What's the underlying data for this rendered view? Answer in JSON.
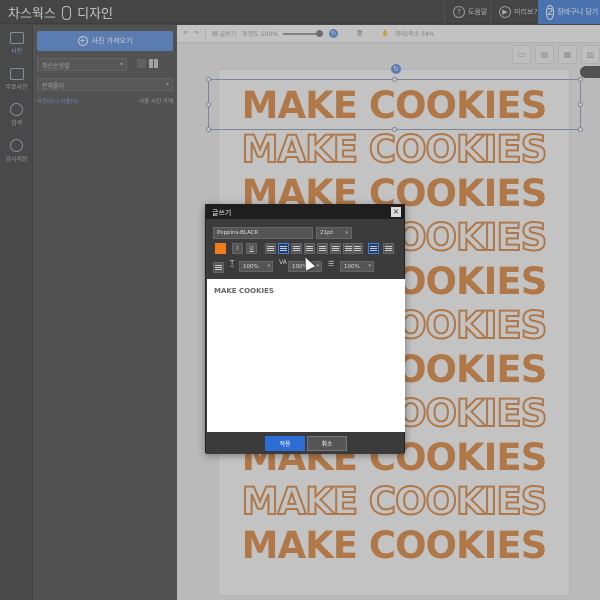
{
  "header": {
    "brand_left": "차스웍스",
    "brand_right": "디자인",
    "buttons": [
      {
        "label": "도움말",
        "icon": "question-icon"
      },
      {
        "label": "미리보기",
        "icon": "play-icon"
      },
      {
        "label": "장바구니 담기",
        "icon": "step-2-icon",
        "step": "2"
      }
    ]
  },
  "rail": [
    {
      "label": "사진",
      "icon": "photo-icon"
    },
    {
      "label": "무료사진",
      "icon": "free-photo-icon"
    },
    {
      "label": "검색",
      "icon": "search-icon"
    },
    {
      "label": "임시저장",
      "icon": "save-icon"
    }
  ],
  "panel": {
    "import_label": "사진 가져오기",
    "sort_value": "최신순정렬",
    "folder_value": "전체폴더",
    "row_left": "사진(0) | 사용(0)",
    "row_right": "사용 사진 삭제"
  },
  "toolbar": {
    "items": [
      "글쓰기",
      "투명도 100%",
      "확대/축소 34%"
    ]
  },
  "poster": {
    "lines": [
      {
        "text": "MAKE COOKIES",
        "style": "solid"
      },
      {
        "text": "MAKE COOKIES",
        "style": "outline"
      },
      {
        "text": "MAKE COOKIES",
        "style": "solid"
      },
      {
        "text": "MAKE COOKIES",
        "style": "outline"
      },
      {
        "text": "MAKE COOKIES",
        "style": "solid"
      },
      {
        "text": "MAKE COOKIES",
        "style": "outline"
      },
      {
        "text": "MAKE COOKIES",
        "style": "solid"
      },
      {
        "text": "MAKE COOKIES",
        "style": "outline"
      },
      {
        "text": "MAKE COOKIES",
        "style": "solid"
      },
      {
        "text": "MAKE COOKIES",
        "style": "outline"
      },
      {
        "text": "MAKE COOKIES",
        "style": "solid"
      }
    ],
    "color": "#d2782a"
  },
  "dialog": {
    "title": "글쓰기",
    "font_value": "Poppins-BLACK",
    "size_value": "21pt",
    "text_color": "#f07d1a",
    "scale_x": "100%",
    "letter_spacing": "100%",
    "line_height": "100%",
    "body_text": "MAKE COOKIES",
    "apply_label": "적용",
    "cancel_label": "취소"
  }
}
